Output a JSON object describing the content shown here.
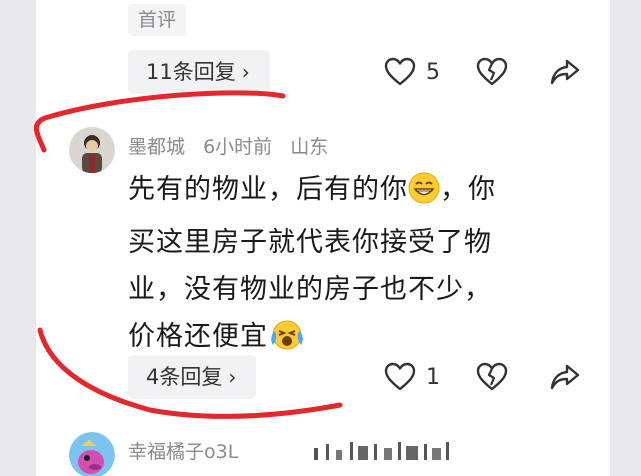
{
  "top_comment": {
    "tag": "首评",
    "replies_label": "11条回复",
    "likes": "5"
  },
  "comment": {
    "username": "墨都城",
    "time": "6小时前",
    "location": "山东",
    "text_line1": "先有的物业，后有的你",
    "text_line1b": "，你",
    "text_line2": "买这里房子就代表你接受了物",
    "text_line3": "业，没有物业的房子也不少，",
    "text_line4": "价格还便宜",
    "replies_label": "4条回复",
    "likes": "1"
  },
  "next_comment": {
    "username": "幸福橘子o3L"
  },
  "icons": {
    "like": "heart-icon",
    "dislike": "broken-heart-icon",
    "share": "share-icon",
    "chevron": "chevron-right-icon"
  },
  "colors": {
    "annotation": "#e0282d",
    "text": "#1a1a1a",
    "muted": "#8a8a8f"
  }
}
